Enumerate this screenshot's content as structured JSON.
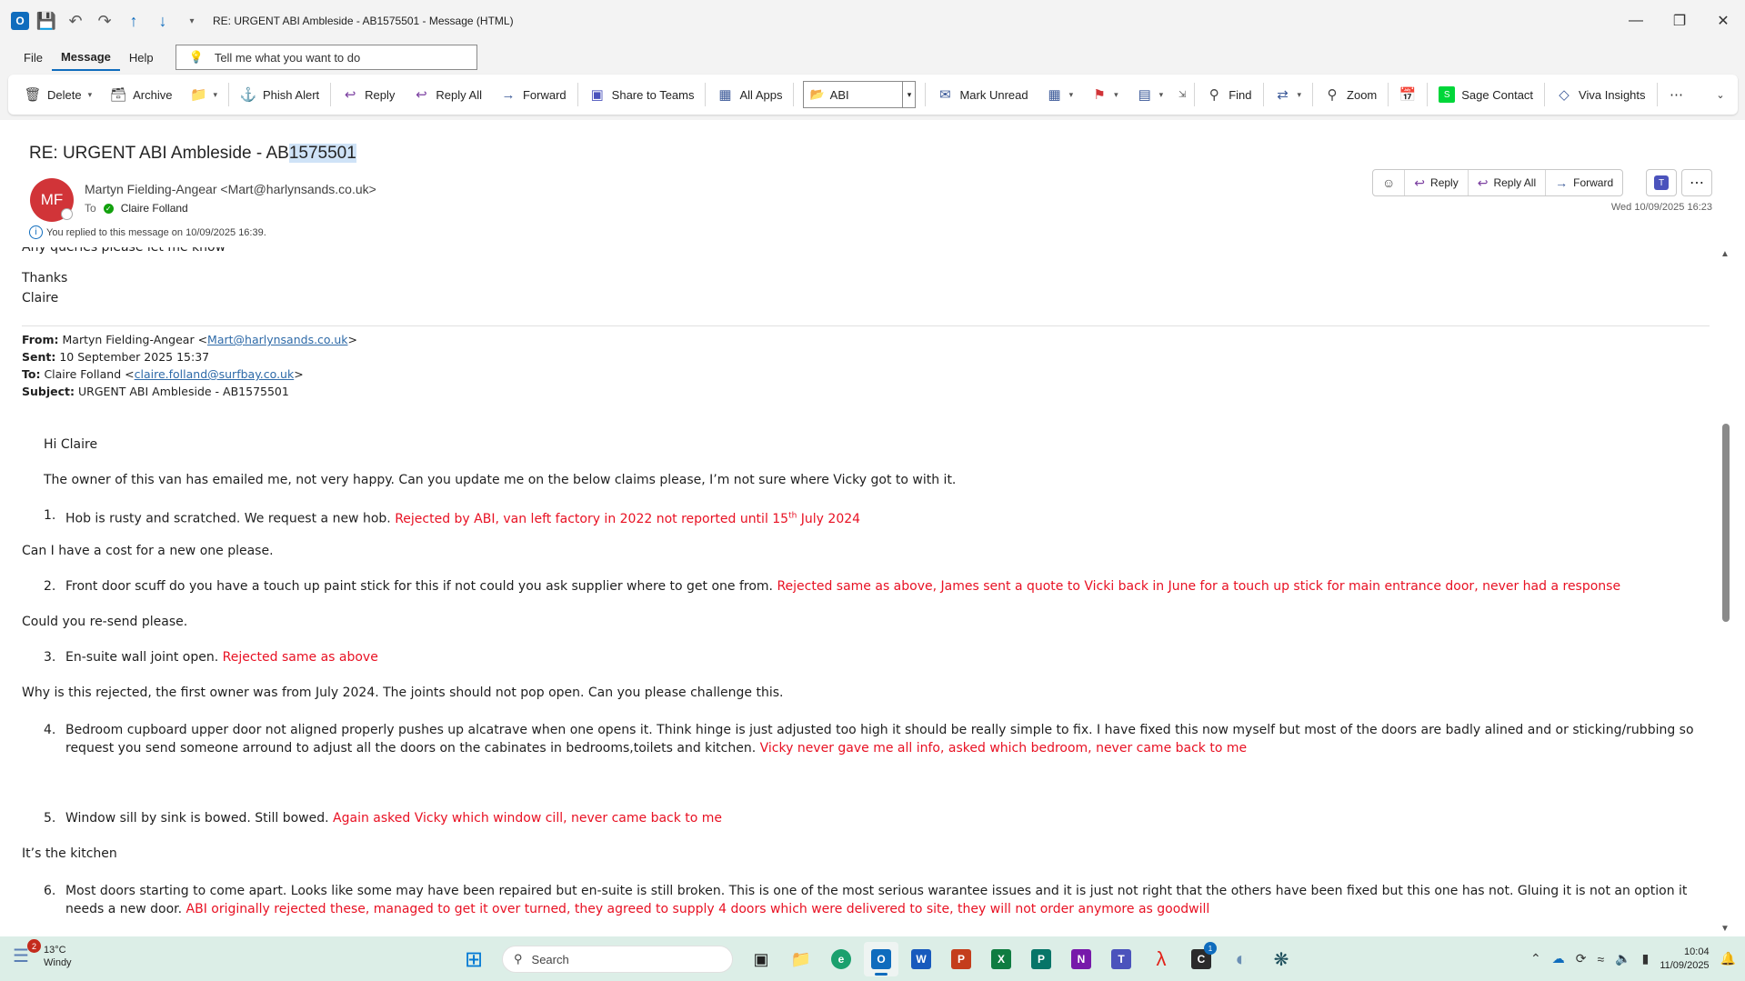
{
  "window": {
    "title": "RE: URGENT ABI Ambleside - AB1575501  -  Message (HTML)",
    "app_icon_letter": "O"
  },
  "menu": {
    "file": "File",
    "message": "Message",
    "help": "Help",
    "tellme_placeholder": "Tell me what you want to do"
  },
  "ribbon": {
    "delete": "Delete",
    "archive": "Archive",
    "phish_alert": "Phish Alert",
    "reply": "Reply",
    "reply_all": "Reply All",
    "forward": "Forward",
    "share_to_teams": "Share to Teams",
    "all_apps": "All Apps",
    "quick_step_value": "ABI",
    "mark_unread": "Mark Unread",
    "find": "Find",
    "zoom": "Zoom",
    "sage_contact": "Sage Contact",
    "viva_insights": "Viva Insights"
  },
  "message": {
    "subject_prefix": "RE: URGENT ABI Ambleside - AB",
    "subject_selected": "1575501",
    "avatar_initials": "MF",
    "sender": "Martyn Fielding-Angear <Mart@harlynsands.co.uk>",
    "to_label": "To",
    "to_name": "Claire Folland",
    "replied_notice": "You replied to this message on 10/09/2025 16:39.",
    "datetime": "Wed 10/09/2025 16:23",
    "actions": {
      "reply": "Reply",
      "reply_all": "Reply All",
      "forward": "Forward"
    }
  },
  "body": {
    "partial_top": "Any queries please let me know",
    "thanks": "Thanks",
    "signoff": "Claire",
    "orig": {
      "from_label": "From:",
      "from_name": "Martyn Fielding-Angear <",
      "from_email": "Mart@harlynsands.co.uk",
      "from_close": ">",
      "sent_label": "Sent:",
      "sent_value": "10 September 2025 15:37",
      "to_label": "To:",
      "to_name": "Claire Folland <",
      "to_email": "claire.folland@surfbay.co.uk",
      "to_close": ">",
      "subject_label": "Subject:",
      "subject_value": "URGENT ABI Ambleside - AB1575501"
    },
    "greeting": "Hi Claire",
    "intro": "The owner of this van has emailed me, not very happy.   Can you update me on the below claims please, I’m not sure where Vicky got to with it.",
    "items": [
      {
        "num": "1.",
        "text": "Hob is rusty and scratched. We request a new hob.",
        "reply": "Rejected by ABI, van left factory in 2022 not reported until 15",
        "reply_sup": "th",
        "reply_end": " July 2024"
      },
      {
        "num": "2.",
        "text": "Front door scuff do you have a touch up paint stick for this if not could you ask supplier where to get one from.",
        "reply": "Rejected same as above, James sent a quote to Vicki back in June for a touch up stick for main entrance door, never had a response"
      },
      {
        "num": "3.",
        "text": "En-suite wall joint open.",
        "reply": "Rejected same as above"
      },
      {
        "num": "4.",
        "text": "Bedroom cupboard upper door not aligned properly pushes up alcatrave when one opens it. Think hinge is just adjusted too high it should be really simple to fix. I have fixed this now myself but most of the doors are badly alined and or sticking/rubbing so request you send someone arround to adjust all the doors on the cabinates in bedrooms,toilets and kitchen.",
        "reply": "Vicky never gave me all info, asked which bedroom, never came back to me"
      },
      {
        "num": "5.",
        "text": "Window sill by sink is bowed. Still bowed.",
        "reply": "Again asked Vicky which window cill, never came back to me"
      },
      {
        "num": "6.",
        "text": "Most doors starting to come apart. Looks like some may have been repaired but en-suite is still broken. This is one of the most serious warantee issues and it is just not right that the others have been fixed but this one has not. Gluing it is not an option it needs a new door.",
        "reply": "ABI originally rejected these, managed to get it over turned, they agreed to supply 4 doors which were delivered to site, they will not order anymore as goodwill"
      }
    ],
    "note1": "Can I have a cost for a new one please.",
    "note2": "Could you re-send please.",
    "note3": "Why is this rejected, the first owner was from July 2024.  The joints should not pop open.  Can you please challenge this.",
    "note5": "It’s the kitchen"
  },
  "taskbar": {
    "weather_temp": "13°C",
    "weather_desc": "Windy",
    "weather_badge": "2",
    "search_label": "Search",
    "app_badge": "1",
    "time": "10:04",
    "date": "11/09/2025"
  },
  "colors": {
    "accent": "#0f6cbd",
    "reply_red": "#e81123",
    "avatar": "#d13438",
    "taskbar_bg": "#dceee7"
  }
}
